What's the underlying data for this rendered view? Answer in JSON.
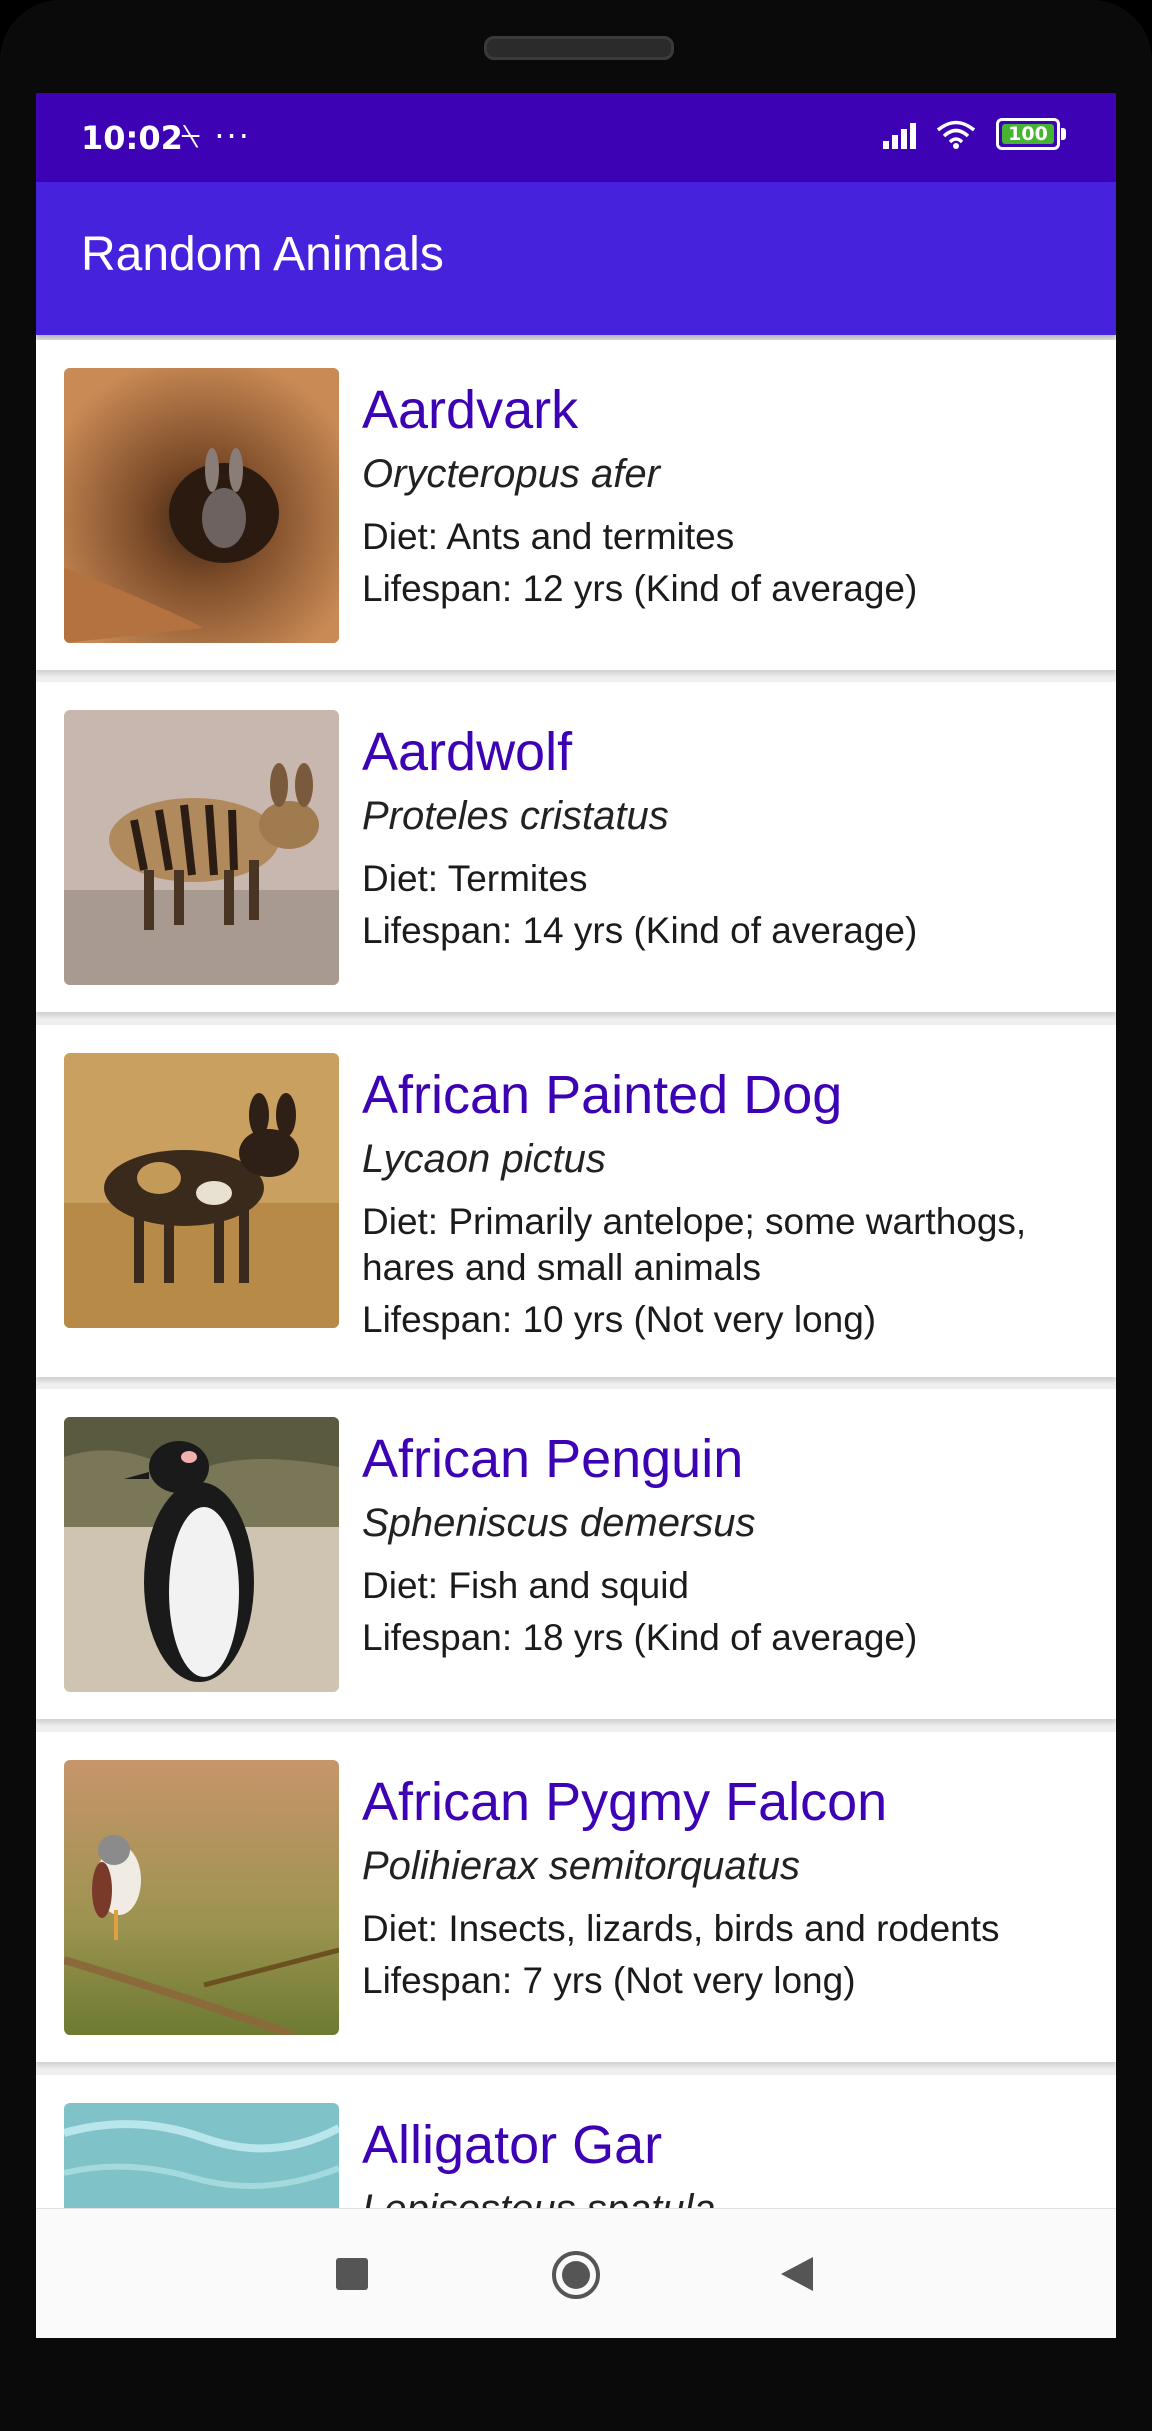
{
  "status_bar": {
    "time": "10:02",
    "left_icons": "⍀ ···",
    "battery": "100",
    "icons": [
      "signal-icon",
      "wifi-icon",
      "battery-icon"
    ]
  },
  "app_bar": {
    "title": "Random Animals"
  },
  "colors": {
    "status_bar": "#3c02b4",
    "app_bar": "#4622dd",
    "accent": "#3c02b4",
    "background": "#efefef"
  },
  "animals": [
    {
      "name": "Aardvark",
      "scientific_name": "Orycteropus afer",
      "diet": "Diet: Ants and termites",
      "lifespan": "Lifespan: 12 yrs (Kind of average)"
    },
    {
      "name": "Aardwolf",
      "scientific_name": "Proteles cristatus",
      "diet": "Diet: Termites",
      "lifespan": "Lifespan: 14 yrs (Kind of average)"
    },
    {
      "name": "African Painted Dog",
      "scientific_name": "Lycaon pictus",
      "diet": "Diet: Primarily antelope; some warthogs, hares and small animals",
      "lifespan": "Lifespan: 10 yrs (Not very long)"
    },
    {
      "name": "African Penguin",
      "scientific_name": "Spheniscus demersus",
      "diet": "Diet: Fish and squid",
      "lifespan": "Lifespan: 18 yrs (Kind of average)"
    },
    {
      "name": "African Pygmy Falcon",
      "scientific_name": "Polihierax semitorquatus",
      "diet": "Diet: Insects, lizards, birds and rodents",
      "lifespan": "Lifespan: 7 yrs (Not very long)"
    },
    {
      "name": "Alligator Gar",
      "scientific_name": "Lepisosteus spatula",
      "diet": "",
      "lifespan": ""
    }
  ],
  "nav_bar": {
    "buttons": [
      "recents-button",
      "home-button",
      "back-button"
    ]
  }
}
